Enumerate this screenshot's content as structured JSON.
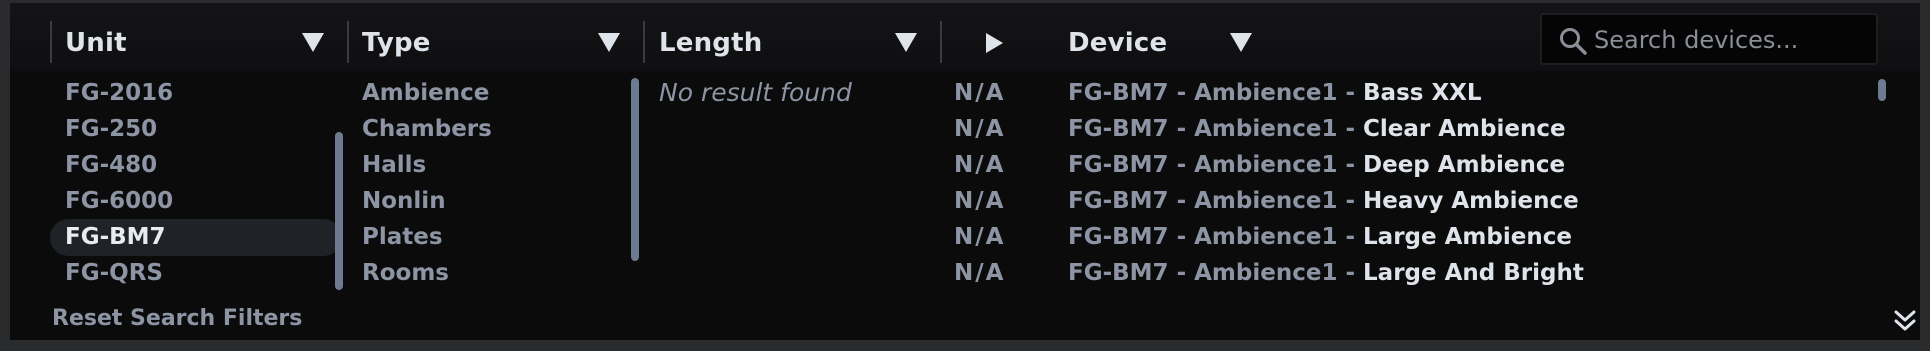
{
  "columns": {
    "unit": "Unit",
    "type": "Type",
    "length": "Length",
    "device": "Device"
  },
  "search": {
    "placeholder": "Search devices...",
    "value": ""
  },
  "units": [
    "FG-2016",
    "FG-250",
    "FG-480",
    "FG-6000",
    "FG-BM7",
    "FG-QRS"
  ],
  "selected_unit": "FG-BM7",
  "types": [
    "Ambience",
    "Chambers",
    "Halls",
    "Nonlin",
    "Plates",
    "Rooms"
  ],
  "length_message": "No result found",
  "rows": [
    {
      "length": "N/A",
      "prefix": "FG-BM7 - Ambience1 - ",
      "name": "Bass XXL"
    },
    {
      "length": "N/A",
      "prefix": "FG-BM7 - Ambience1 - ",
      "name": "Clear Ambience"
    },
    {
      "length": "N/A",
      "prefix": "FG-BM7 - Ambience1 - ",
      "name": "Deep Ambience"
    },
    {
      "length": "N/A",
      "prefix": "FG-BM7 - Ambience1 - ",
      "name": "Heavy Ambience"
    },
    {
      "length": "N/A",
      "prefix": "FG-BM7 - Ambience1 - ",
      "name": "Large Ambience"
    },
    {
      "length": "N/A",
      "prefix": "FG-BM7 - Ambience1 - ",
      "name": "Large And Bright"
    }
  ],
  "footer": {
    "reset_label": "Reset Search Filters"
  },
  "icons": {
    "sort_indicator": "triangle-down-icon",
    "preview": "play-icon",
    "search": "search-icon",
    "expand": "double-chevron-down-icon"
  },
  "colors": {
    "background": "#0b0b0c",
    "text_primary": "#dfe3ea",
    "text_secondary": "#8d95a4",
    "selection": "#1f2328",
    "scrollbar": "#6d7b90"
  }
}
